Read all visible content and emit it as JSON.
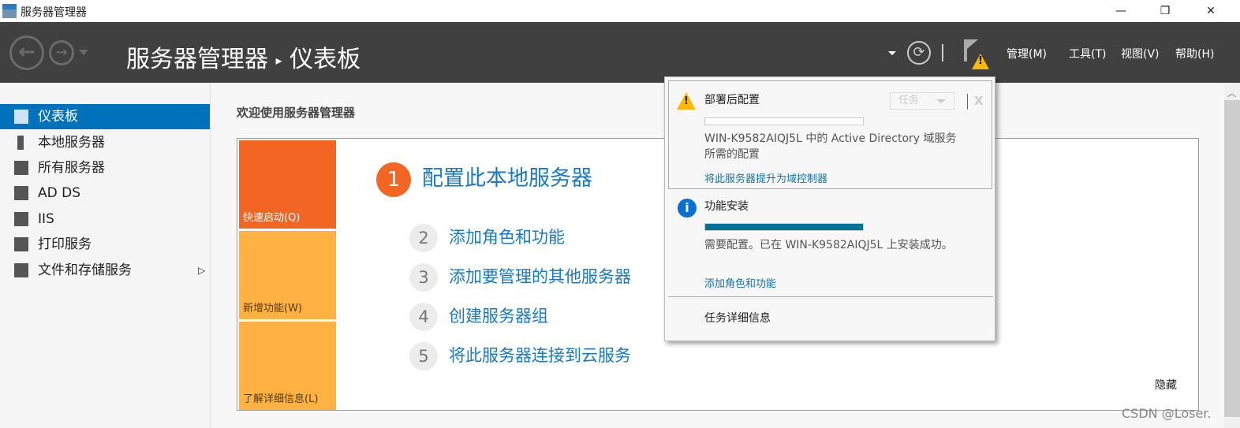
{
  "window": {
    "title": "服务器管理器",
    "min": "—",
    "max": "❐",
    "close": "✕"
  },
  "header": {
    "app": "服务器管理器",
    "sep": "▸",
    "page": "仪表板",
    "refresh_icon": "refresh-icon",
    "menus": [
      "管理(M)",
      "工具(T)",
      "视图(V)",
      "帮助(H)"
    ]
  },
  "sidebar": {
    "items": [
      {
        "label": "仪表板"
      },
      {
        "label": "本地服务器"
      },
      {
        "label": "所有服务器"
      },
      {
        "label": "AD DS"
      },
      {
        "label": "IIS"
      },
      {
        "label": "打印服务"
      },
      {
        "label": "文件和存储服务"
      }
    ]
  },
  "main": {
    "welcome": "欢迎使用服务器管理器",
    "tiles": [
      "快速启动(Q)",
      "新增功能(W)",
      "了解详细信息(L)"
    ],
    "steps": [
      {
        "n": "1",
        "label": "配置此本地服务器"
      },
      {
        "n": "2",
        "label": "添加角色和功能"
      },
      {
        "n": "3",
        "label": "添加要管理的其他服务器"
      },
      {
        "n": "4",
        "label": "创建服务器组"
      },
      {
        "n": "5",
        "label": "将此服务器连接到云服务"
      }
    ],
    "hide": "隐藏"
  },
  "popup": {
    "n1": {
      "title": "部署后配置",
      "task": "任务",
      "close": "X",
      "progress": 0,
      "text1": "WIN-K9582AIQJ5L 中的 Active Directory 域服务",
      "text2": "所需的配置",
      "link": "将此服务器提升为域控制器"
    },
    "n2": {
      "title": "功能安装",
      "progress": 100,
      "text": "需要配置。已在 WIN-K9582AIQJ5L 上安装成功。",
      "link": "添加角色和功能"
    },
    "details": "任务详细信息"
  },
  "colors": {
    "accent": "#0072bc",
    "orange": "#f26522",
    "yellow": "#ffb142",
    "progress": "#007396"
  },
  "watermark": "CSDN @Loser‌."
}
